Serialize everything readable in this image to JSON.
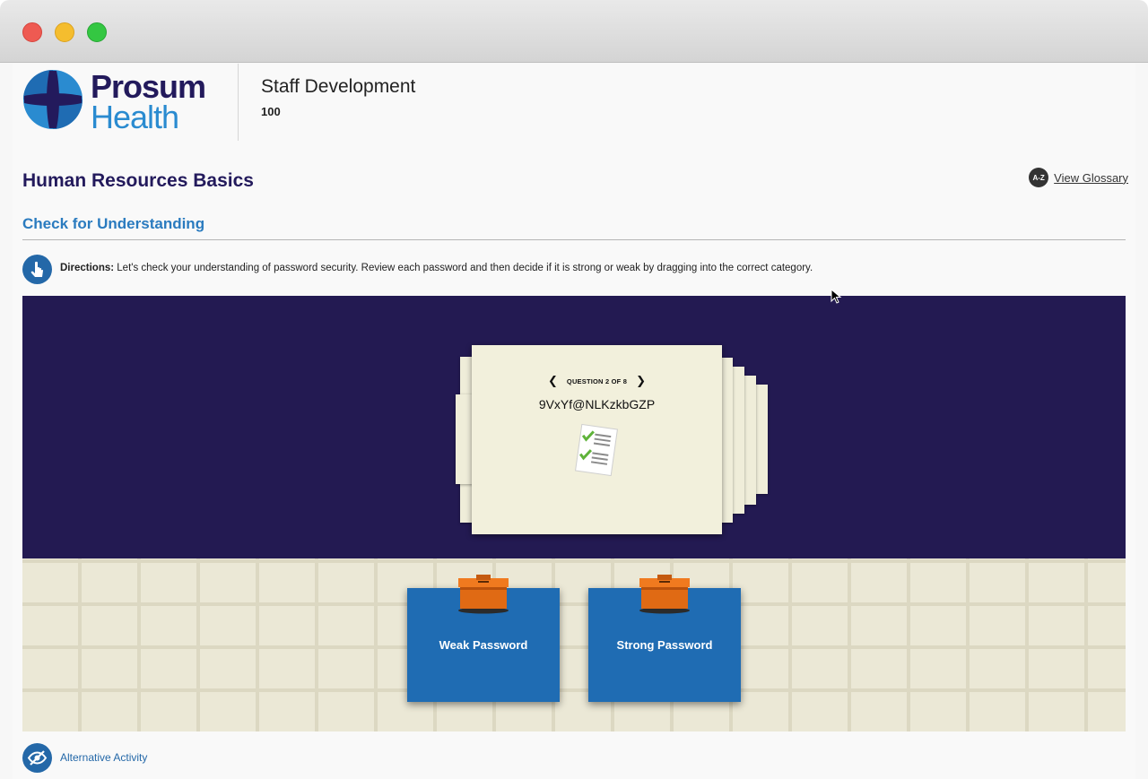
{
  "window": {
    "controls": [
      "close",
      "minimize",
      "zoom"
    ]
  },
  "header": {
    "logo": {
      "line1": "Prosum",
      "line2": "Health"
    },
    "course_title": "Staff Development",
    "course_number": "100"
  },
  "page": {
    "title": "Human Resources Basics",
    "glossary": {
      "icon_text": "A-Z",
      "label": "View Glossary"
    },
    "section_title": "Check for Understanding"
  },
  "directions": {
    "label": "Directions:",
    "text": " Let's check your understanding of password security. Review each password and then decide if it is strong or weak by dragging into the correct category."
  },
  "activity": {
    "question_label": "QUESTION 2 OF 8",
    "prev_icon": "chevron-left-icon",
    "next_icon": "chevron-right-icon",
    "password": "9VxYf@NLKzkbGZP",
    "bins": [
      {
        "label": "Weak Password"
      },
      {
        "label": "Strong Password"
      }
    ]
  },
  "footer": {
    "alternative_label": "Alternative Activity"
  },
  "colors": {
    "brand_navy": "#231a5c",
    "brand_blue": "#2a8bd0",
    "stage_bg": "#231a52",
    "bin_blue": "#1f6cb3",
    "card": "#f2f0dc"
  }
}
